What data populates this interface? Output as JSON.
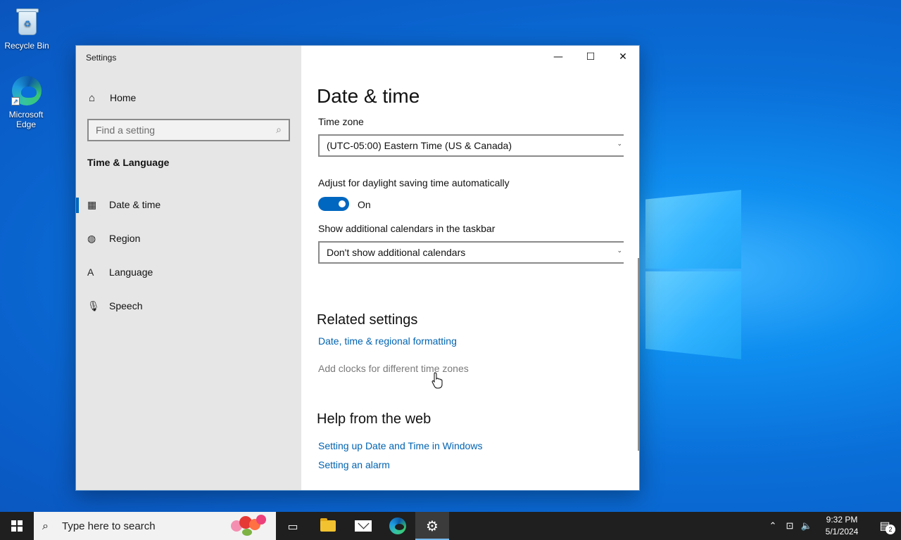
{
  "desktop": {
    "recycle_bin_label": "Recycle Bin",
    "edge_label": "Microsoft Edge"
  },
  "window": {
    "title": "Settings",
    "minimize": "—",
    "maximize": "☐",
    "close": "✕"
  },
  "sidebar": {
    "home_label": "Home",
    "search_placeholder": "Find a setting",
    "section_title": "Time & Language",
    "items": [
      {
        "label": "Date & time",
        "icon": "calendar-clock-icon",
        "active": true
      },
      {
        "label": "Region",
        "icon": "globe-icon",
        "active": false
      },
      {
        "label": "Language",
        "icon": "language-icon",
        "active": false
      },
      {
        "label": "Speech",
        "icon": "microphone-icon",
        "active": false
      }
    ]
  },
  "main": {
    "title": "Date & time",
    "time_zone_label": "Time zone",
    "time_zone_value": "(UTC-05:00) Eastern Time (US & Canada)",
    "daylight_label": "Adjust for daylight saving time automatically",
    "daylight_state": "On",
    "calendars_label": "Show additional calendars in the taskbar",
    "calendars_value": "Don't show additional calendars",
    "related_title": "Related settings",
    "related_links": [
      "Date, time & regional formatting",
      "Add clocks for different time zones"
    ],
    "help_title": "Help from the web",
    "help_links": [
      "Setting up Date and Time in Windows",
      "Setting an alarm"
    ]
  },
  "taskbar": {
    "search_placeholder": "Type here to search",
    "time": "9:32 PM",
    "date": "5/1/2024",
    "notification_count": "2"
  },
  "colors": {
    "accent": "#0067c0",
    "link": "#0063b1",
    "sidebar_bg": "#e6e6e6",
    "taskbar_bg": "#1f1f1f"
  }
}
